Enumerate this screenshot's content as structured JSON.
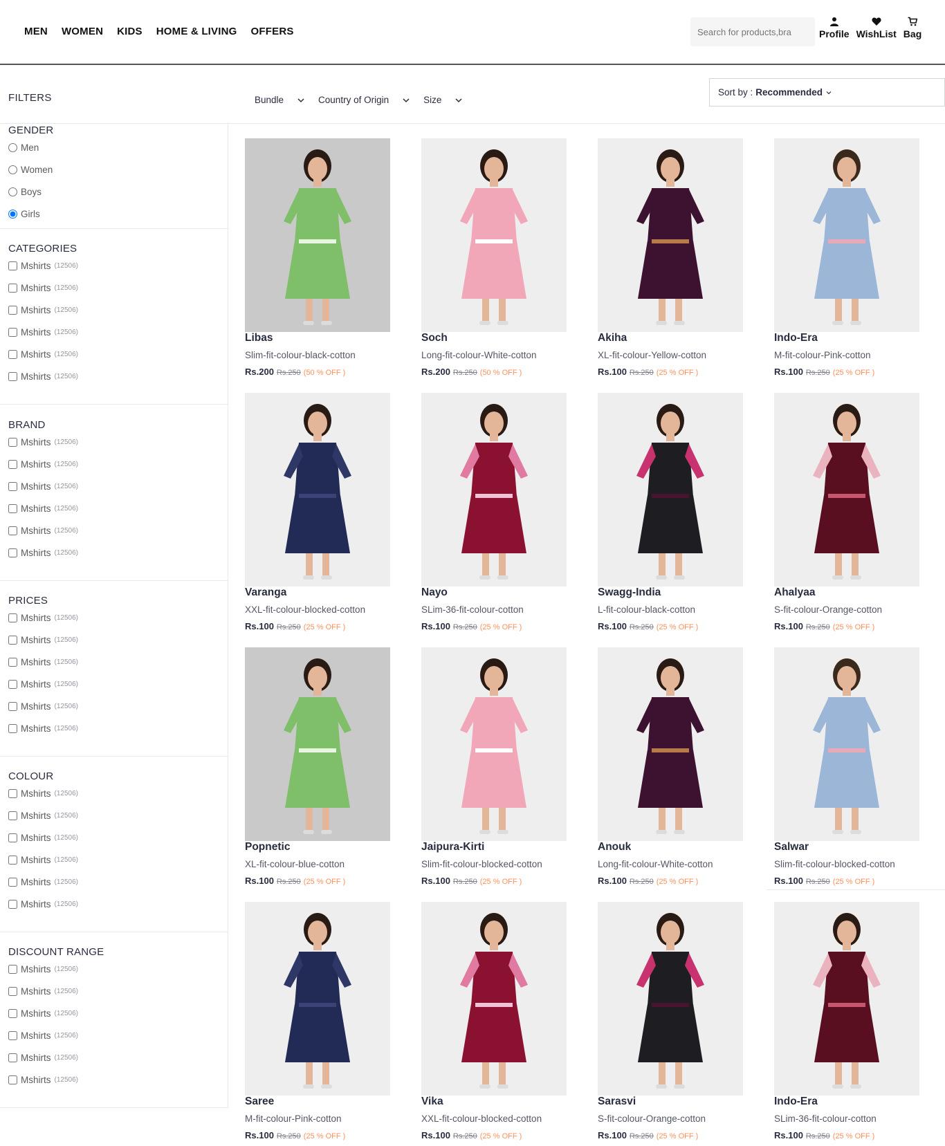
{
  "nav": {
    "items": [
      "MEN",
      "WOMEN",
      "KIDS",
      "HOME & LIVING",
      "OFFERS"
    ]
  },
  "search": {
    "placeholder": "Search for products,bra"
  },
  "header_icons": {
    "profile": "Profile",
    "wishlist": "WishList",
    "bag": "Bag"
  },
  "filters_title": "FILTERS",
  "horizontal_filters": [
    "Bundle",
    "Country of Origin",
    "Size"
  ],
  "sort": {
    "label": "Sort by :",
    "value": "Recommended"
  },
  "gender": {
    "title": "GENDER",
    "options": [
      "Men",
      "Women",
      "Boys",
      "Girls"
    ],
    "selected": "Girls"
  },
  "facets": [
    {
      "title": "CATEGORIES",
      "options": [
        {
          "label": "Mshirts",
          "count": "(12506)"
        },
        {
          "label": "Mshirts",
          "count": "(12506)"
        },
        {
          "label": "Mshirts",
          "count": "(12506)"
        },
        {
          "label": "Mshirts",
          "count": "(12506)"
        },
        {
          "label": "Mshirts",
          "count": "(12506)"
        },
        {
          "label": "Mshirts",
          "count": "(12506)"
        }
      ]
    },
    {
      "title": "BRAND",
      "options": [
        {
          "label": "Mshirts",
          "count": "(12506)"
        },
        {
          "label": "Mshirts",
          "count": "(12506)"
        },
        {
          "label": "Mshirts",
          "count": "(12506)"
        },
        {
          "label": "Mshirts",
          "count": "(12506)"
        },
        {
          "label": "Mshirts",
          "count": "(12506)"
        },
        {
          "label": "Mshirts",
          "count": "(12506)"
        }
      ]
    },
    {
      "title": "PRICES",
      "options": [
        {
          "label": "Mshirts",
          "count": "(12506)"
        },
        {
          "label": "Mshirts",
          "count": "(12506)"
        },
        {
          "label": "Mshirts",
          "count": "(12506)"
        },
        {
          "label": "Mshirts",
          "count": "(12506)"
        },
        {
          "label": "Mshirts",
          "count": "(12506)"
        },
        {
          "label": "Mshirts",
          "count": "(12506)"
        }
      ]
    },
    {
      "title": "COLOUR",
      "options": [
        {
          "label": "Mshirts",
          "count": "(12506)"
        },
        {
          "label": "Mshirts",
          "count": "(12506)"
        },
        {
          "label": "Mshirts",
          "count": "(12506)"
        },
        {
          "label": "Mshirts",
          "count": "(12506)"
        },
        {
          "label": "Mshirts",
          "count": "(12506)"
        },
        {
          "label": "Mshirts",
          "count": "(12506)"
        }
      ]
    },
    {
      "title": "DISCOUNT RANGE",
      "options": [
        {
          "label": "Mshirts",
          "count": "(12506)"
        },
        {
          "label": "Mshirts",
          "count": "(12506)"
        },
        {
          "label": "Mshirts",
          "count": "(12506)"
        },
        {
          "label": "Mshirts",
          "count": "(12506)"
        },
        {
          "label": "Mshirts",
          "count": "(12506)"
        },
        {
          "label": "Mshirts",
          "count": "(12506)"
        }
      ]
    }
  ],
  "products": [
    {
      "brand": "Libas",
      "desc": "Slim-fit-colour-black-cotton",
      "price": "Rs.200",
      "mrp": "Rs.250",
      "off": "(50 % OFF )",
      "dress": "green-floral"
    },
    {
      "brand": "Soch",
      "desc": "Long-fit-colour-White-cotton",
      "price": "Rs.200",
      "mrp": "Rs.250",
      "off": "(50 % OFF )",
      "dress": "pink-floral"
    },
    {
      "brand": "Akiha",
      "desc": "XL-fit-colour-Yellow-cotton",
      "price": "Rs.100",
      "mrp": "Rs.250",
      "off": "(25 % OFF )",
      "dress": "purple-velvet"
    },
    {
      "brand": "Indo-Era",
      "desc": "M-fit-colour-Pink-cotton",
      "price": "Rs.100",
      "mrp": "Rs.250",
      "off": "(25 % OFF )",
      "dress": "denim"
    },
    {
      "brand": "Varanga",
      "desc": "XXL-fit-colour-blocked-cotton",
      "price": "Rs.100",
      "mrp": "Rs.250",
      "off": "(25 % OFF )",
      "dress": "navy"
    },
    {
      "brand": "Nayo",
      "desc": "SLim-36-fit-colour-cotton",
      "price": "Rs.100",
      "mrp": "Rs.250",
      "off": "(25 % OFF )",
      "dress": "maroon-sequin"
    },
    {
      "brand": "Swagg-India",
      "desc": "L-fit-colour-black-cotton",
      "price": "Rs.100",
      "mrp": "Rs.250",
      "off": "(25 % OFF )",
      "dress": "black-check"
    },
    {
      "brand": "Ahalyaa",
      "desc": "S-fit-colour-Orange-cotton",
      "price": "Rs.100",
      "mrp": "Rs.250",
      "off": "(25 % OFF )",
      "dress": "maroon-check"
    },
    {
      "brand": "Popnetic",
      "desc": "XL-fit-colour-blue-cotton",
      "price": "Rs.100",
      "mrp": "Rs.250",
      "off": "(25 % OFF )",
      "dress": "green-floral"
    },
    {
      "brand": "Jaipura-Kirti",
      "desc": "Slim-fit-colour-blocked-cotton",
      "price": "Rs.100",
      "mrp": "Rs.250",
      "off": "(25 % OFF )",
      "dress": "pink-floral"
    },
    {
      "brand": "Anouk",
      "desc": "Long-fit-colour-White-cotton",
      "price": "Rs.100",
      "mrp": "Rs.250",
      "off": "(25 % OFF )",
      "dress": "purple-velvet"
    },
    {
      "brand": "Salwar",
      "desc": "Slim-fit-colour-blocked-cotton",
      "price": "Rs.100",
      "mrp": "Rs.250",
      "off": "(25 % OFF )",
      "dress": "denim"
    },
    {
      "brand": "Saree",
      "desc": "M-fit-colour-Pink-cotton",
      "price": "Rs.100",
      "mrp": "Rs.250",
      "off": "(25 % OFF )",
      "dress": "navy"
    },
    {
      "brand": "Vika",
      "desc": "XXL-fit-colour-blocked-cotton",
      "price": "Rs.100",
      "mrp": "Rs.250",
      "off": "(25 % OFF )",
      "dress": "maroon-sequin"
    },
    {
      "brand": "Sarasvi",
      "desc": "S-fit-colour-Orange-cotton",
      "price": "Rs.100",
      "mrp": "Rs.250",
      "off": "(25 % OFF )",
      "dress": "black-check"
    },
    {
      "brand": "Indo-Era",
      "desc": "SLim-36-fit-colour-cotton",
      "price": "Rs.100",
      "mrp": "Rs.250",
      "off": "(25 % OFF )",
      "dress": "maroon-check"
    }
  ],
  "colors": {
    "discount": "#ff905a",
    "radio_selected": "#1a73e8",
    "image_bg_grey": "#cfcfcf",
    "image_bg_light": "#efefef"
  }
}
